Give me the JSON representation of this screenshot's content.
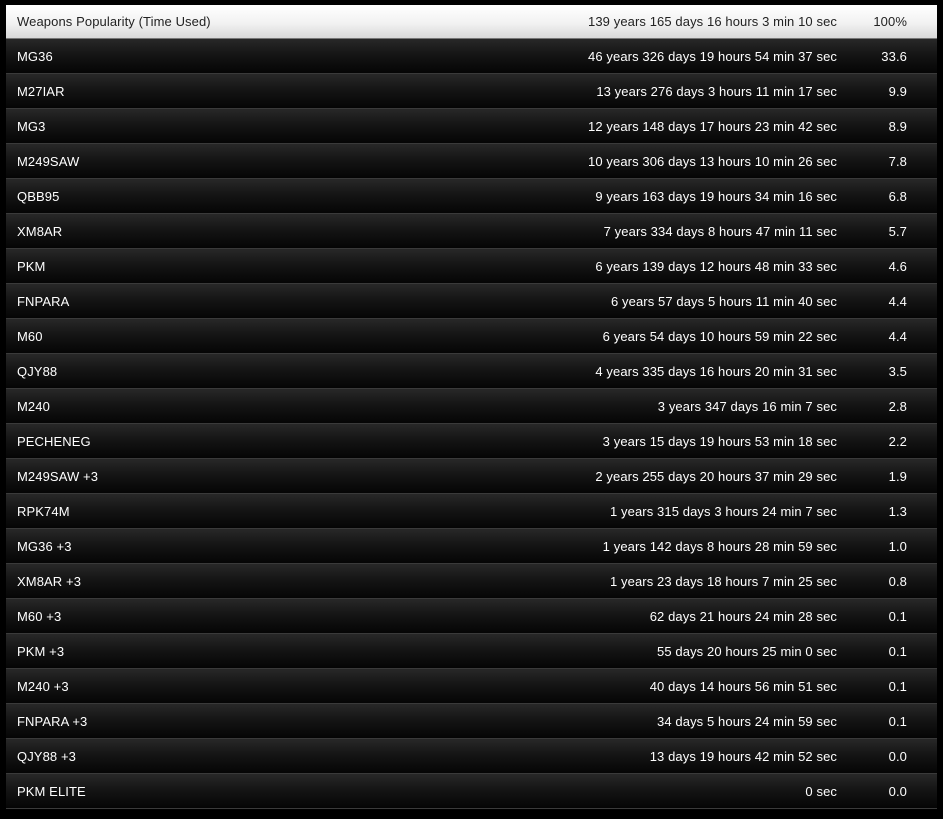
{
  "header": {
    "title": "Weapons Popularity (Time Used)",
    "total_time": "139 years 165 days 16 hours 3 min 10 sec",
    "total_percent": "100%"
  },
  "rows": [
    {
      "name": "MG36",
      "time": "46 years 326 days 19 hours 54 min 37 sec",
      "percent": "33.6"
    },
    {
      "name": "M27IAR",
      "time": "13 years 276 days 3 hours 11 min 17 sec",
      "percent": "9.9"
    },
    {
      "name": "MG3",
      "time": "12 years 148 days 17 hours 23 min 42 sec",
      "percent": "8.9"
    },
    {
      "name": "M249SAW",
      "time": "10 years 306 days 13 hours 10 min 26 sec",
      "percent": "7.8"
    },
    {
      "name": "QBB95",
      "time": "9 years 163 days 19 hours 34 min 16 sec",
      "percent": "6.8"
    },
    {
      "name": "XM8AR",
      "time": "7 years 334 days 8 hours 47 min 11 sec",
      "percent": "5.7"
    },
    {
      "name": "PKM",
      "time": "6 years 139 days 12 hours 48 min 33 sec",
      "percent": "4.6"
    },
    {
      "name": "FNPARA",
      "time": "6 years 57 days 5 hours 11 min 40 sec",
      "percent": "4.4"
    },
    {
      "name": "M60",
      "time": "6 years 54 days 10 hours 59 min 22 sec",
      "percent": "4.4"
    },
    {
      "name": "QJY88",
      "time": "4 years 335 days 16 hours 20 min 31 sec",
      "percent": "3.5"
    },
    {
      "name": "M240",
      "time": "3 years 347 days 16 min 7 sec",
      "percent": "2.8"
    },
    {
      "name": "PECHENEG",
      "time": "3 years 15 days 19 hours 53 min 18 sec",
      "percent": "2.2"
    },
    {
      "name": "M249SAW +3",
      "time": "2 years 255 days 20 hours 37 min 29 sec",
      "percent": "1.9"
    },
    {
      "name": "RPK74M",
      "time": "1 years 315 days 3 hours 24 min 7 sec",
      "percent": "1.3"
    },
    {
      "name": "MG36 +3",
      "time": "1 years 142 days 8 hours 28 min 59 sec",
      "percent": "1.0"
    },
    {
      "name": "XM8AR +3",
      "time": "1 years 23 days 18 hours 7 min 25 sec",
      "percent": "0.8"
    },
    {
      "name": "M60 +3",
      "time": "62 days 21 hours 24 min 28 sec",
      "percent": "0.1"
    },
    {
      "name": "PKM +3",
      "time": "55 days 20 hours 25 min 0 sec",
      "percent": "0.1"
    },
    {
      "name": "M240 +3",
      "time": "40 days 14 hours 56 min 51 sec",
      "percent": "0.1"
    },
    {
      "name": "FNPARA +3",
      "time": "34 days 5 hours 24 min 59 sec",
      "percent": "0.1"
    },
    {
      "name": "QJY88 +3",
      "time": "13 days 19 hours 42 min 52 sec",
      "percent": "0.0"
    },
    {
      "name": "PKM ELITE",
      "time": "0 sec",
      "percent": "0.0"
    }
  ]
}
